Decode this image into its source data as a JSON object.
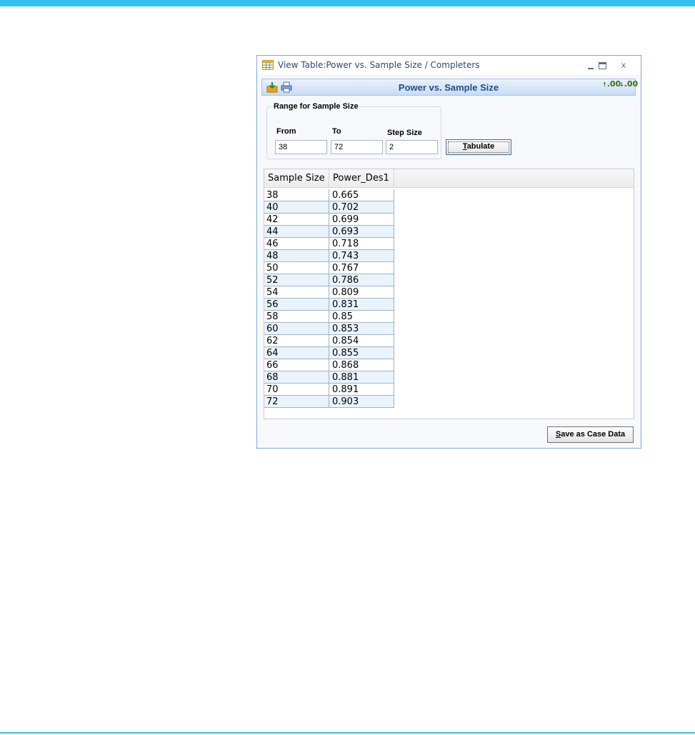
{
  "window": {
    "title": "View Table:Power vs. Sample Size / Completers",
    "minimize_icon": "minimize-icon",
    "maximize_icon": "maximize-icon",
    "close_label": "x"
  },
  "toolbar": {
    "title": "Power vs. Sample Size",
    "export_icon": "export-icon",
    "print_icon": "print-icon",
    "increase_decimals_label": ".00",
    "decrease_decimals_label": ".00"
  },
  "range": {
    "legend": "Range for Sample Size",
    "from_label": "From",
    "to_label": "To",
    "step_label": "Step Size",
    "from_value": "38",
    "to_value": "72",
    "step_value": "2",
    "tabulate_label": "Tabulate"
  },
  "table": {
    "columns": [
      "Sample Size",
      "Power_Des1"
    ],
    "rows": [
      [
        "38",
        "0.665"
      ],
      [
        "40",
        "0.702"
      ],
      [
        "42",
        "0.699"
      ],
      [
        "44",
        "0.693"
      ],
      [
        "46",
        "0.718"
      ],
      [
        "48",
        "0.743"
      ],
      [
        "50",
        "0.767"
      ],
      [
        "52",
        "0.786"
      ],
      [
        "54",
        "0.809"
      ],
      [
        "56",
        "0.831"
      ],
      [
        "58",
        "0.85"
      ],
      [
        "60",
        "0.853"
      ],
      [
        "62",
        "0.854"
      ],
      [
        "64",
        "0.855"
      ],
      [
        "66",
        "0.868"
      ],
      [
        "68",
        "0.881"
      ],
      [
        "70",
        "0.891"
      ],
      [
        "72",
        "0.903"
      ]
    ]
  },
  "footer": {
    "save_label": "Save as Case Data"
  },
  "colors": {
    "accent": "#33bff0",
    "toolbar_title": "#1f4e8c",
    "alt_row": "#e8f3fc"
  }
}
